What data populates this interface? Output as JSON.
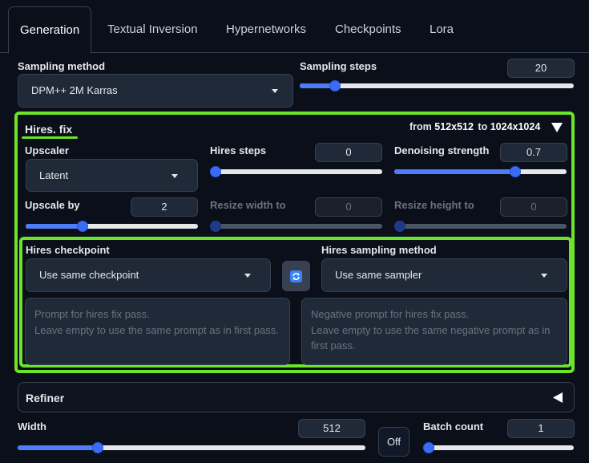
{
  "tabs": [
    {
      "label": "Generation",
      "active": true
    },
    {
      "label": "Textual Inversion",
      "active": false
    },
    {
      "label": "Hypernetworks",
      "active": false
    },
    {
      "label": "Checkpoints",
      "active": false
    },
    {
      "label": "Lora",
      "active": false
    }
  ],
  "sampling": {
    "method_label": "Sampling method",
    "method_value": "DPM++ 2M Karras",
    "steps_label": "Sampling steps",
    "steps_value": "20",
    "steps_level": 0.13
  },
  "hires": {
    "title": "Hires. fix",
    "from_prefix": "from",
    "from_size": "512x512",
    "to_prefix": "to",
    "to_size": "1024x1024",
    "upscaler_label": "Upscaler",
    "upscaler_value": "Latent",
    "hires_steps_label": "Hires steps",
    "hires_steps_value": "0",
    "hires_steps_level": 0.0,
    "denoise_label": "Denoising strength",
    "denoise_value": "0.7",
    "denoise_level": 0.7,
    "upscale_by_label": "Upscale by",
    "upscale_by_value": "2",
    "upscale_by_level": 0.33,
    "resize_w_label": "Resize width to",
    "resize_w_value": "0",
    "resize_h_label": "Resize height to",
    "resize_h_value": "0",
    "checkpoint_label": "Hires checkpoint",
    "checkpoint_value": "Use same checkpoint",
    "sampler_label": "Hires sampling method",
    "sampler_value": "Use same sampler",
    "prompt_placeholder_line1": "Prompt for hires fix pass.",
    "prompt_placeholder_line2": "Leave empty to use the same prompt as in first pass.",
    "neg_placeholder_line1": "Negative prompt for hires fix pass.",
    "neg_placeholder_line2": "Leave empty to use the same negative prompt as in",
    "neg_placeholder_line3": "first pass."
  },
  "refiner": {
    "title": "Refiner"
  },
  "size": {
    "width_label": "Width",
    "width_value": "512",
    "width_level": 0.23,
    "off_label": "Off",
    "batch_label": "Batch count",
    "batch_value": "1",
    "batch_level": 0.0
  },
  "colors": {
    "accent": "#3b6cf5",
    "highlight": "#6be42a",
    "refresh": "#3b82f6"
  }
}
